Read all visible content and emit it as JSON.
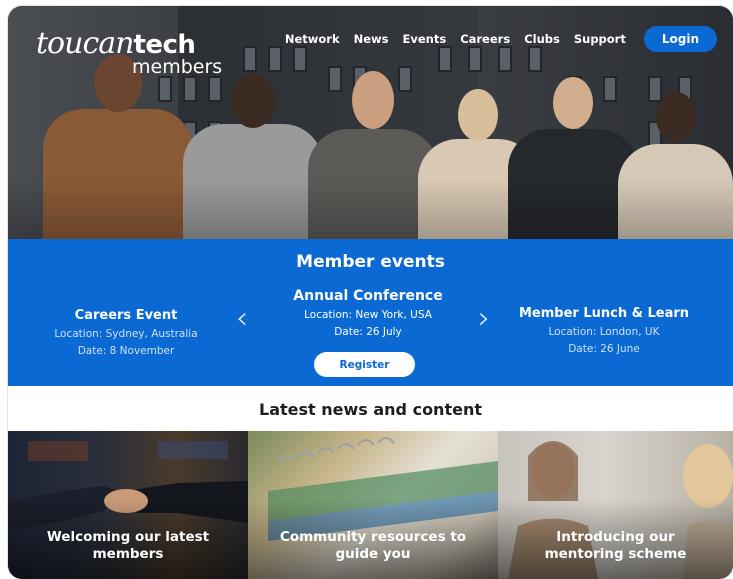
{
  "brand": {
    "script": "toucan",
    "bold": "tech",
    "sub": "members"
  },
  "nav": {
    "items": [
      "Network",
      "News",
      "Events",
      "Careers",
      "Clubs",
      "Support"
    ],
    "login": "Login"
  },
  "events": {
    "title": "Member events",
    "left": {
      "name": "Careers Event",
      "location": "Location: Sydney, Australia",
      "date": "Date: 8 November"
    },
    "center": {
      "name": "Annual Conference",
      "location": "Location: New York, USA",
      "date": "Date: 26 July"
    },
    "right": {
      "name": "Member Lunch & Learn",
      "location": "Location: London, UK",
      "date": "Date: 26 June"
    },
    "register": "Register",
    "prev_glyph": "‹",
    "next_glyph": "›"
  },
  "news": {
    "title": "Latest news and content",
    "cards": [
      {
        "label": "Welcoming our latest members"
      },
      {
        "label": "Community resources to guide you"
      },
      {
        "label": "Introducing our mentoring scheme"
      }
    ]
  },
  "colors": {
    "accent": "#0b69d4"
  }
}
